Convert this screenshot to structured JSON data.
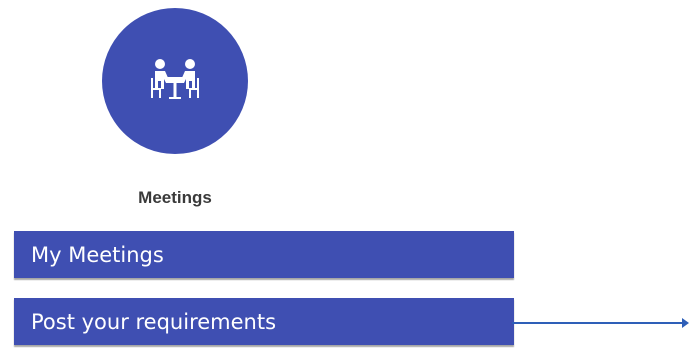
{
  "app": {
    "label": "Meetings",
    "icon": "meeting-table-icon",
    "accent_color": "#3f4fb2"
  },
  "menu": {
    "items": [
      {
        "label": "My Meetings"
      },
      {
        "label": "Post your requirements"
      }
    ]
  },
  "annotation": {
    "icon": "right-arrow-icon",
    "color": "#2e5fb8"
  }
}
